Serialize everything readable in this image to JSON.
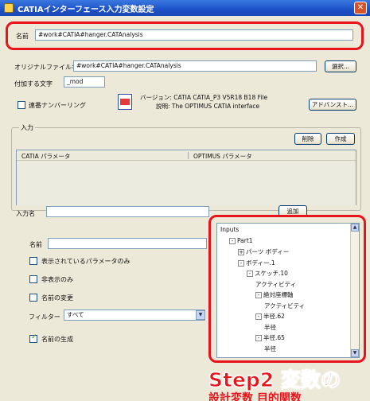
{
  "window": {
    "title": "CATIAインターフェース入力変数設定",
    "close": "✕"
  },
  "name_field": {
    "label": "名前",
    "value": "#work#CATIA#hanger.CATAnalysis"
  },
  "original_file": {
    "label": "オリジナルファイル名",
    "value": "#work#CATIA#hanger.CATAnalysis",
    "browse": "選択..."
  },
  "suffix": {
    "label": "付加する文字",
    "value": "_mod"
  },
  "serial_numbering": {
    "label": "連番ナンバーリング",
    "checked": false
  },
  "version_info": {
    "line1": "バージョン: CATIA CATIA_P3 V5R18 B18 File",
    "line2": "説明: The OPTIMUS CATIA interface",
    "advanced": "アドバンスト..."
  },
  "input_section": {
    "group_label": "入力",
    "delete": "削除",
    "create": "作成",
    "col_catia": "CATIA パラメータ",
    "col_optimus": "OPTIMUS パラメータ"
  },
  "input_name": {
    "label": "入力名",
    "add": "追加"
  },
  "left_options": {
    "name_label": "名前",
    "show_displayed": "表示されているパラメータのみ",
    "hidden_only": "非表示のみ",
    "rename": "名前の変更",
    "filter_label": "フィルター",
    "filter_value": "すべて",
    "generate_name": "名前の生成",
    "generate_name_checked": true
  },
  "tree": [
    {
      "text": "Inputs",
      "level": 0,
      "toggle": ""
    },
    {
      "text": "Part1",
      "level": 1,
      "toggle": "-"
    },
    {
      "text": "パーツ ボディー",
      "level": 2,
      "toggle": "+"
    },
    {
      "text": "ボディー.1",
      "level": 2,
      "toggle": "-"
    },
    {
      "text": "スケッチ.10",
      "level": 3,
      "toggle": "-"
    },
    {
      "text": "アクティビティ",
      "level": 4,
      "toggle": ""
    },
    {
      "text": "絶対座標軸",
      "level": 4,
      "toggle": "-"
    },
    {
      "text": "アクティビティ",
      "level": 5,
      "toggle": ""
    },
    {
      "text": "半径.62",
      "level": 4,
      "toggle": "-"
    },
    {
      "text": "半径",
      "level": 5,
      "toggle": ""
    },
    {
      "text": "半径.65",
      "level": 4,
      "toggle": "-"
    },
    {
      "text": "半径",
      "level": 5,
      "toggle": ""
    }
  ],
  "annotation": {
    "title": "Step2 変数の",
    "subtitle": "設計変数 目的関数"
  },
  "colors": {
    "highlight": "#e8141c",
    "titlebar": "#1d52c6"
  }
}
